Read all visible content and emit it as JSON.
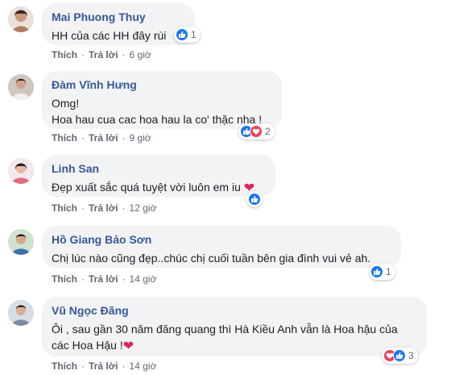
{
  "comments": [
    {
      "author": "Mai Phuong Thuy",
      "lines": [
        "HH của các HH đây rùi"
      ],
      "reactions": "1",
      "like_label": "Thích",
      "reply_label": "Trả lời",
      "time": "6 giờ",
      "reaction_types": [
        "like"
      ]
    },
    {
      "author": "Đàm Vĩnh Hưng",
      "lines": [
        "Omg!",
        "Hoa hau cua cac hoa hau la co' thặc nha !"
      ],
      "reactions": "2",
      "like_label": "Thích",
      "reply_label": "Trả lời",
      "time": "9 giờ",
      "reaction_types": [
        "like",
        "love"
      ]
    },
    {
      "author": "Linh San",
      "lines": [
        "Đẹp xuất sắc quá tuyệt vời luôn em iu"
      ],
      "reactions": "",
      "like_label": "Thích",
      "reply_label": "Trả lời",
      "time": "12 giờ",
      "reaction_types": [
        "like"
      ]
    },
    {
      "author": "Hồ Giang Bảo Sơn",
      "lines": [
        "Chị lúc nào cũng đẹp..chúc chị cuối tuần bên gia đình vui vẻ ah."
      ],
      "reactions": "1",
      "like_label": "Thích",
      "reply_label": "Trả lời",
      "time": "14 giờ",
      "reaction_types": [
        "like"
      ]
    },
    {
      "author": "Vũ Ngọc Đãng",
      "lines": [
        "Ôi , sau gần 30 năm đăng quang thì Hà Kiều Anh vẫn là Hoa hậu của",
        "các Hoa Hậu !"
      ],
      "reactions": "3",
      "like_label": "Thích",
      "reply_label": "Trả lời",
      "time": "14 giờ",
      "reaction_types": [
        "love",
        "like"
      ]
    }
  ],
  "icons": {
    "like": "thumbs-up-icon",
    "love": "heart-icon"
  },
  "colors": {
    "author": "#385898",
    "bubble": "#f2f3f5",
    "like": "#1877f2",
    "love": "#f33e58",
    "meta": "#606770"
  }
}
